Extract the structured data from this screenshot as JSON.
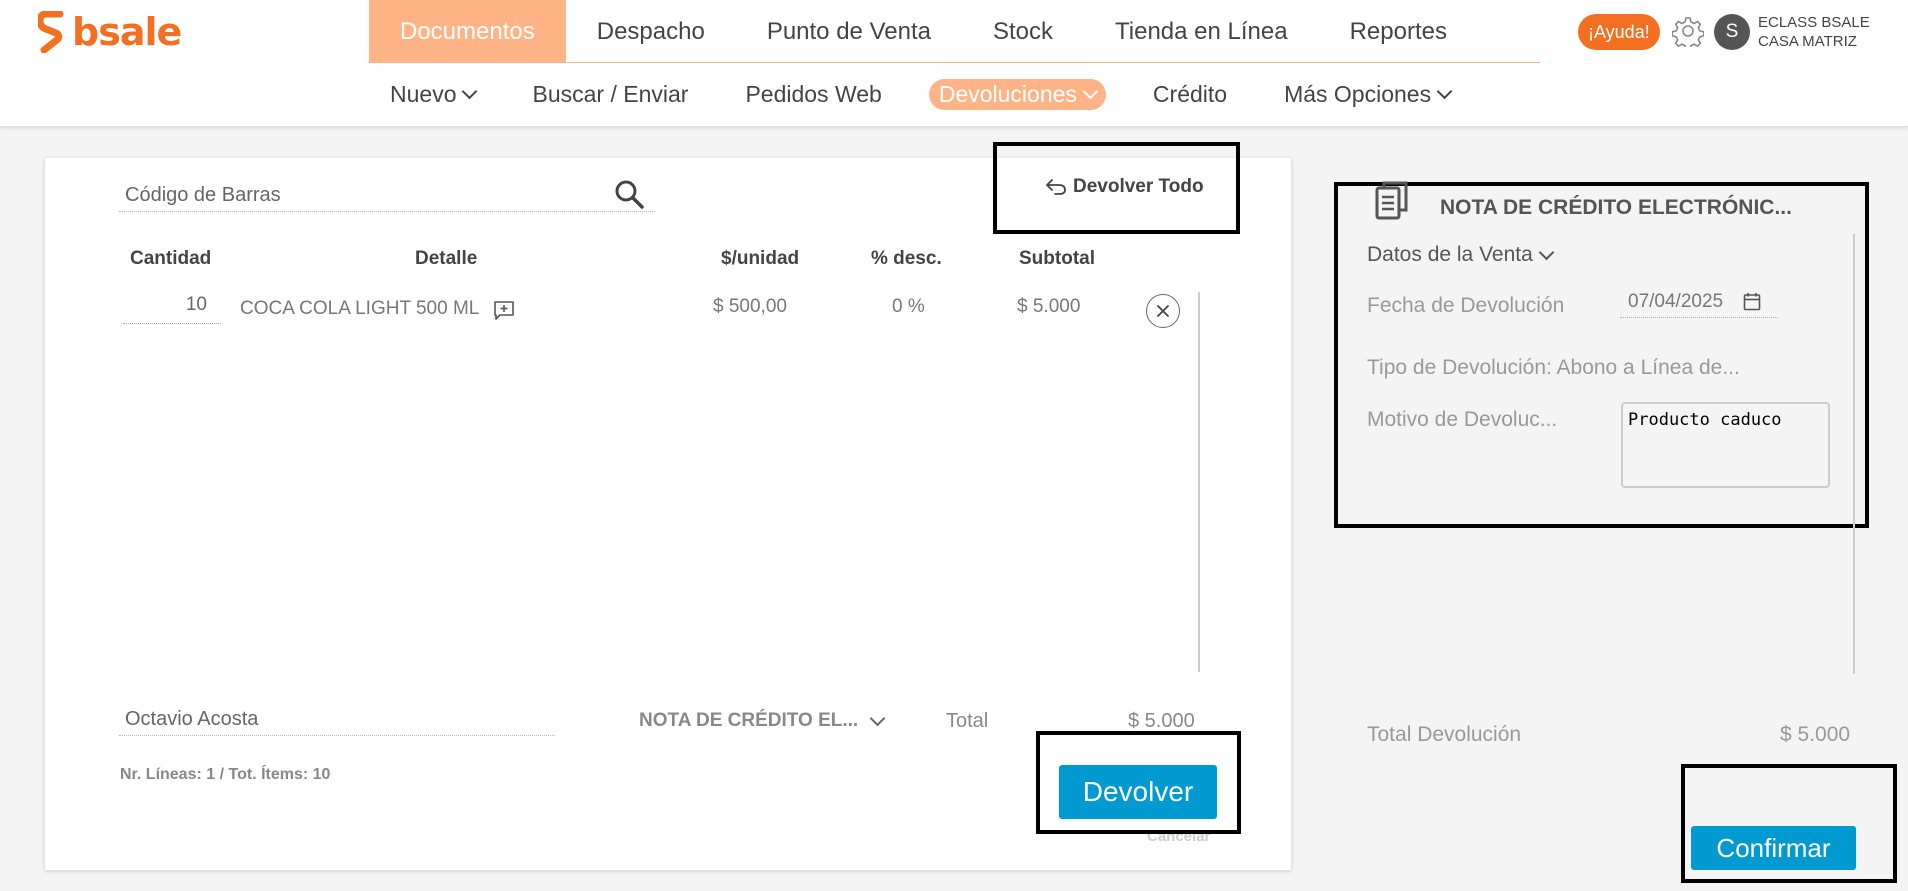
{
  "header": {
    "logo": "bsale",
    "nav": [
      "Documentos",
      "Despacho",
      "Punto de Venta",
      "Stock",
      "Tienda en Línea",
      "Reportes"
    ],
    "active_nav": "Documentos",
    "help_label": "¡Ayuda!",
    "avatar_initial": "S",
    "company_line1": "ECLASS BSALE",
    "company_line2": "CASA MATRIZ"
  },
  "subnav": {
    "items": [
      {
        "label": "Nuevo",
        "dropdown": true
      },
      {
        "label": "Buscar / Enviar",
        "dropdown": false
      },
      {
        "label": "Pedidos Web",
        "dropdown": false
      },
      {
        "label": "Devoluciones",
        "dropdown": true,
        "active": true
      },
      {
        "label": "Crédito",
        "dropdown": false
      },
      {
        "label": "Más Opciones",
        "dropdown": true
      }
    ]
  },
  "return_form": {
    "barcode_placeholder": "Código de Barras",
    "return_all_label": "Devolver Todo",
    "columns": {
      "quantity": "Cantidad",
      "detail": "Detalle",
      "unit_price": "$/unidad",
      "discount": "% desc.",
      "subtotal": "Subtotal"
    },
    "rows": [
      {
        "quantity": "10",
        "detail": "COCA COLA LIGHT 500 ML",
        "unit_price": "$ 500,00",
        "discount": "0 %",
        "subtotal": "$ 5.000"
      }
    ],
    "client": "Octavio Acosta",
    "document_type": "NOTA DE CRÉDITO EL...",
    "total_label": "Total",
    "total_value": "$ 5.000",
    "lines_info": "Nr. Líneas: 1 / Tot. Ítems: 10",
    "return_button": "Devolver",
    "cancel_link": "Cancelar"
  },
  "side_panel": {
    "title": "NOTA DE CRÉDITO ELECTRÓNIC...",
    "sale_data": "Datos de la Venta",
    "return_date_label": "Fecha de Devolución",
    "return_date": "07/04/2025",
    "return_type": "Tipo de Devolución: Abono a Línea de...",
    "reason_label": "Motivo de Devoluc...",
    "reason_value": "Producto caduco",
    "total_label": "Total Devolución",
    "total_value": "$ 5.000",
    "confirm_button": "Confirmar"
  },
  "colors": {
    "brand_orange": "#f36f21",
    "active_tab": "#ffb387",
    "primary_button": "#0099d0"
  }
}
